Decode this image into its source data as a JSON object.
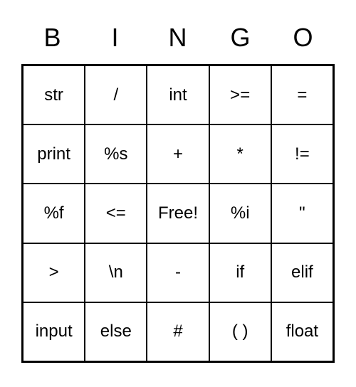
{
  "header": [
    "B",
    "I",
    "N",
    "G",
    "O"
  ],
  "cells": [
    "str",
    "/",
    "int",
    ">=",
    "=",
    "print",
    "%s",
    "+",
    "*",
    "!=",
    "%f",
    "<=",
    "Free!",
    "%i",
    "\"",
    ">",
    "\\n",
    "-",
    "if",
    "elif",
    "input",
    "else",
    "#",
    "( )",
    "float"
  ]
}
